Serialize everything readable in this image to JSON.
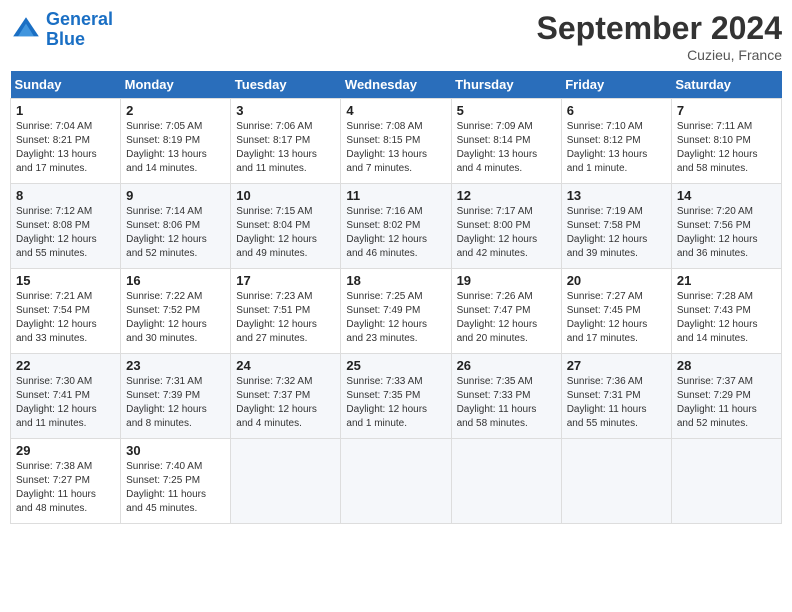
{
  "header": {
    "logo_line1": "General",
    "logo_line2": "Blue",
    "month_title": "September 2024",
    "location": "Cuzieu, France"
  },
  "calendar": {
    "days_of_week": [
      "Sunday",
      "Monday",
      "Tuesday",
      "Wednesday",
      "Thursday",
      "Friday",
      "Saturday"
    ],
    "weeks": [
      [
        {
          "day": "1",
          "sunrise": "7:04 AM",
          "sunset": "8:21 PM",
          "daylight": "13 hours and 17 minutes."
        },
        {
          "day": "2",
          "sunrise": "7:05 AM",
          "sunset": "8:19 PM",
          "daylight": "13 hours and 14 minutes."
        },
        {
          "day": "3",
          "sunrise": "7:06 AM",
          "sunset": "8:17 PM",
          "daylight": "13 hours and 11 minutes."
        },
        {
          "day": "4",
          "sunrise": "7:08 AM",
          "sunset": "8:15 PM",
          "daylight": "13 hours and 7 minutes."
        },
        {
          "day": "5",
          "sunrise": "7:09 AM",
          "sunset": "8:14 PM",
          "daylight": "13 hours and 4 minutes."
        },
        {
          "day": "6",
          "sunrise": "7:10 AM",
          "sunset": "8:12 PM",
          "daylight": "13 hours and 1 minute."
        },
        {
          "day": "7",
          "sunrise": "7:11 AM",
          "sunset": "8:10 PM",
          "daylight": "12 hours and 58 minutes."
        }
      ],
      [
        {
          "day": "8",
          "sunrise": "7:12 AM",
          "sunset": "8:08 PM",
          "daylight": "12 hours and 55 minutes."
        },
        {
          "day": "9",
          "sunrise": "7:14 AM",
          "sunset": "8:06 PM",
          "daylight": "12 hours and 52 minutes."
        },
        {
          "day": "10",
          "sunrise": "7:15 AM",
          "sunset": "8:04 PM",
          "daylight": "12 hours and 49 minutes."
        },
        {
          "day": "11",
          "sunrise": "7:16 AM",
          "sunset": "8:02 PM",
          "daylight": "12 hours and 46 minutes."
        },
        {
          "day": "12",
          "sunrise": "7:17 AM",
          "sunset": "8:00 PM",
          "daylight": "12 hours and 42 minutes."
        },
        {
          "day": "13",
          "sunrise": "7:19 AM",
          "sunset": "7:58 PM",
          "daylight": "12 hours and 39 minutes."
        },
        {
          "day": "14",
          "sunrise": "7:20 AM",
          "sunset": "7:56 PM",
          "daylight": "12 hours and 36 minutes."
        }
      ],
      [
        {
          "day": "15",
          "sunrise": "7:21 AM",
          "sunset": "7:54 PM",
          "daylight": "12 hours and 33 minutes."
        },
        {
          "day": "16",
          "sunrise": "7:22 AM",
          "sunset": "7:52 PM",
          "daylight": "12 hours and 30 minutes."
        },
        {
          "day": "17",
          "sunrise": "7:23 AM",
          "sunset": "7:51 PM",
          "daylight": "12 hours and 27 minutes."
        },
        {
          "day": "18",
          "sunrise": "7:25 AM",
          "sunset": "7:49 PM",
          "daylight": "12 hours and 23 minutes."
        },
        {
          "day": "19",
          "sunrise": "7:26 AM",
          "sunset": "7:47 PM",
          "daylight": "12 hours and 20 minutes."
        },
        {
          "day": "20",
          "sunrise": "7:27 AM",
          "sunset": "7:45 PM",
          "daylight": "12 hours and 17 minutes."
        },
        {
          "day": "21",
          "sunrise": "7:28 AM",
          "sunset": "7:43 PM",
          "daylight": "12 hours and 14 minutes."
        }
      ],
      [
        {
          "day": "22",
          "sunrise": "7:30 AM",
          "sunset": "7:41 PM",
          "daylight": "12 hours and 11 minutes."
        },
        {
          "day": "23",
          "sunrise": "7:31 AM",
          "sunset": "7:39 PM",
          "daylight": "12 hours and 8 minutes."
        },
        {
          "day": "24",
          "sunrise": "7:32 AM",
          "sunset": "7:37 PM",
          "daylight": "12 hours and 4 minutes."
        },
        {
          "day": "25",
          "sunrise": "7:33 AM",
          "sunset": "7:35 PM",
          "daylight": "12 hours and 1 minute."
        },
        {
          "day": "26",
          "sunrise": "7:35 AM",
          "sunset": "7:33 PM",
          "daylight": "11 hours and 58 minutes."
        },
        {
          "day": "27",
          "sunrise": "7:36 AM",
          "sunset": "7:31 PM",
          "daylight": "11 hours and 55 minutes."
        },
        {
          "day": "28",
          "sunrise": "7:37 AM",
          "sunset": "7:29 PM",
          "daylight": "11 hours and 52 minutes."
        }
      ],
      [
        {
          "day": "29",
          "sunrise": "7:38 AM",
          "sunset": "7:27 PM",
          "daylight": "11 hours and 48 minutes."
        },
        {
          "day": "30",
          "sunrise": "7:40 AM",
          "sunset": "7:25 PM",
          "daylight": "11 hours and 45 minutes."
        },
        null,
        null,
        null,
        null,
        null
      ]
    ]
  }
}
